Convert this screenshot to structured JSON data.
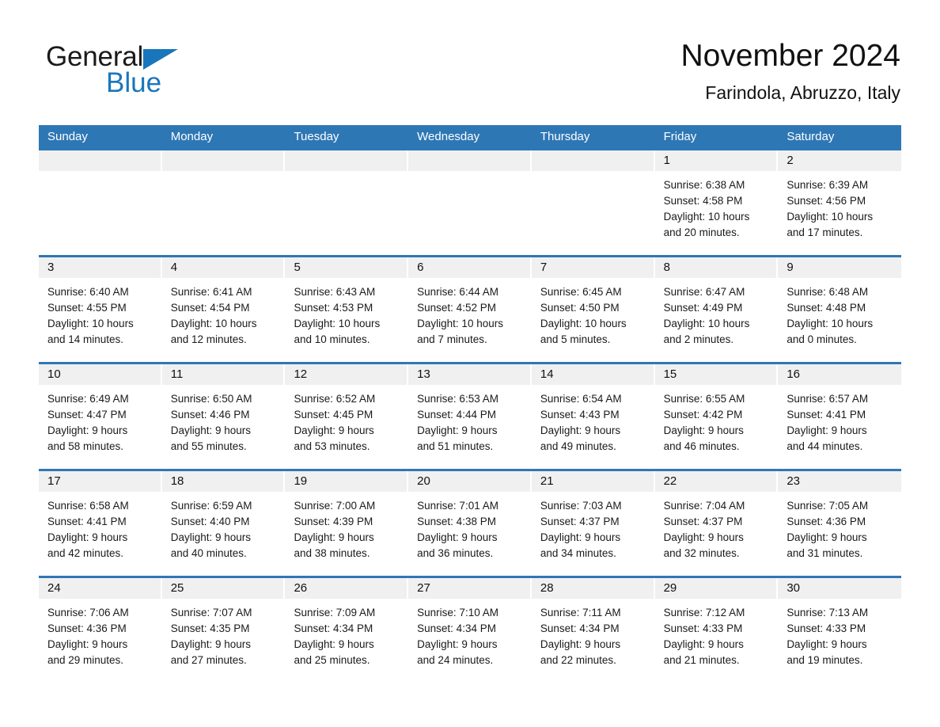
{
  "brand": {
    "name_part1": "General",
    "name_part2": "Blue",
    "flag_icon": "triangle-flag-icon",
    "accent_color": "#1a76bc"
  },
  "header": {
    "title": "November 2024",
    "subtitle": "Farindola, Abruzzo, Italy"
  },
  "colors": {
    "header_blue": "#2e77b5",
    "day_band_gray": "#f0f0f0",
    "text": "#1a1a1a"
  },
  "weekdays": [
    "Sunday",
    "Monday",
    "Tuesday",
    "Wednesday",
    "Thursday",
    "Friday",
    "Saturday"
  ],
  "weeks": [
    [
      {
        "day": "",
        "sunrise": "",
        "sunset": "",
        "daylight_line1": "",
        "daylight_line2": ""
      },
      {
        "day": "",
        "sunrise": "",
        "sunset": "",
        "daylight_line1": "",
        "daylight_line2": ""
      },
      {
        "day": "",
        "sunrise": "",
        "sunset": "",
        "daylight_line1": "",
        "daylight_line2": ""
      },
      {
        "day": "",
        "sunrise": "",
        "sunset": "",
        "daylight_line1": "",
        "daylight_line2": ""
      },
      {
        "day": "",
        "sunrise": "",
        "sunset": "",
        "daylight_line1": "",
        "daylight_line2": ""
      },
      {
        "day": "1",
        "sunrise": "Sunrise: 6:38 AM",
        "sunset": "Sunset: 4:58 PM",
        "daylight_line1": "Daylight: 10 hours",
        "daylight_line2": "and 20 minutes."
      },
      {
        "day": "2",
        "sunrise": "Sunrise: 6:39 AM",
        "sunset": "Sunset: 4:56 PM",
        "daylight_line1": "Daylight: 10 hours",
        "daylight_line2": "and 17 minutes."
      }
    ],
    [
      {
        "day": "3",
        "sunrise": "Sunrise: 6:40 AM",
        "sunset": "Sunset: 4:55 PM",
        "daylight_line1": "Daylight: 10 hours",
        "daylight_line2": "and 14 minutes."
      },
      {
        "day": "4",
        "sunrise": "Sunrise: 6:41 AM",
        "sunset": "Sunset: 4:54 PM",
        "daylight_line1": "Daylight: 10 hours",
        "daylight_line2": "and 12 minutes."
      },
      {
        "day": "5",
        "sunrise": "Sunrise: 6:43 AM",
        "sunset": "Sunset: 4:53 PM",
        "daylight_line1": "Daylight: 10 hours",
        "daylight_line2": "and 10 minutes."
      },
      {
        "day": "6",
        "sunrise": "Sunrise: 6:44 AM",
        "sunset": "Sunset: 4:52 PM",
        "daylight_line1": "Daylight: 10 hours",
        "daylight_line2": "and 7 minutes."
      },
      {
        "day": "7",
        "sunrise": "Sunrise: 6:45 AM",
        "sunset": "Sunset: 4:50 PM",
        "daylight_line1": "Daylight: 10 hours",
        "daylight_line2": "and 5 minutes."
      },
      {
        "day": "8",
        "sunrise": "Sunrise: 6:47 AM",
        "sunset": "Sunset: 4:49 PM",
        "daylight_line1": "Daylight: 10 hours",
        "daylight_line2": "and 2 minutes."
      },
      {
        "day": "9",
        "sunrise": "Sunrise: 6:48 AM",
        "sunset": "Sunset: 4:48 PM",
        "daylight_line1": "Daylight: 10 hours",
        "daylight_line2": "and 0 minutes."
      }
    ],
    [
      {
        "day": "10",
        "sunrise": "Sunrise: 6:49 AM",
        "sunset": "Sunset: 4:47 PM",
        "daylight_line1": "Daylight: 9 hours",
        "daylight_line2": "and 58 minutes."
      },
      {
        "day": "11",
        "sunrise": "Sunrise: 6:50 AM",
        "sunset": "Sunset: 4:46 PM",
        "daylight_line1": "Daylight: 9 hours",
        "daylight_line2": "and 55 minutes."
      },
      {
        "day": "12",
        "sunrise": "Sunrise: 6:52 AM",
        "sunset": "Sunset: 4:45 PM",
        "daylight_line1": "Daylight: 9 hours",
        "daylight_line2": "and 53 minutes."
      },
      {
        "day": "13",
        "sunrise": "Sunrise: 6:53 AM",
        "sunset": "Sunset: 4:44 PM",
        "daylight_line1": "Daylight: 9 hours",
        "daylight_line2": "and 51 minutes."
      },
      {
        "day": "14",
        "sunrise": "Sunrise: 6:54 AM",
        "sunset": "Sunset: 4:43 PM",
        "daylight_line1": "Daylight: 9 hours",
        "daylight_line2": "and 49 minutes."
      },
      {
        "day": "15",
        "sunrise": "Sunrise: 6:55 AM",
        "sunset": "Sunset: 4:42 PM",
        "daylight_line1": "Daylight: 9 hours",
        "daylight_line2": "and 46 minutes."
      },
      {
        "day": "16",
        "sunrise": "Sunrise: 6:57 AM",
        "sunset": "Sunset: 4:41 PM",
        "daylight_line1": "Daylight: 9 hours",
        "daylight_line2": "and 44 minutes."
      }
    ],
    [
      {
        "day": "17",
        "sunrise": "Sunrise: 6:58 AM",
        "sunset": "Sunset: 4:41 PM",
        "daylight_line1": "Daylight: 9 hours",
        "daylight_line2": "and 42 minutes."
      },
      {
        "day": "18",
        "sunrise": "Sunrise: 6:59 AM",
        "sunset": "Sunset: 4:40 PM",
        "daylight_line1": "Daylight: 9 hours",
        "daylight_line2": "and 40 minutes."
      },
      {
        "day": "19",
        "sunrise": "Sunrise: 7:00 AM",
        "sunset": "Sunset: 4:39 PM",
        "daylight_line1": "Daylight: 9 hours",
        "daylight_line2": "and 38 minutes."
      },
      {
        "day": "20",
        "sunrise": "Sunrise: 7:01 AM",
        "sunset": "Sunset: 4:38 PM",
        "daylight_line1": "Daylight: 9 hours",
        "daylight_line2": "and 36 minutes."
      },
      {
        "day": "21",
        "sunrise": "Sunrise: 7:03 AM",
        "sunset": "Sunset: 4:37 PM",
        "daylight_line1": "Daylight: 9 hours",
        "daylight_line2": "and 34 minutes."
      },
      {
        "day": "22",
        "sunrise": "Sunrise: 7:04 AM",
        "sunset": "Sunset: 4:37 PM",
        "daylight_line1": "Daylight: 9 hours",
        "daylight_line2": "and 32 minutes."
      },
      {
        "day": "23",
        "sunrise": "Sunrise: 7:05 AM",
        "sunset": "Sunset: 4:36 PM",
        "daylight_line1": "Daylight: 9 hours",
        "daylight_line2": "and 31 minutes."
      }
    ],
    [
      {
        "day": "24",
        "sunrise": "Sunrise: 7:06 AM",
        "sunset": "Sunset: 4:36 PM",
        "daylight_line1": "Daylight: 9 hours",
        "daylight_line2": "and 29 minutes."
      },
      {
        "day": "25",
        "sunrise": "Sunrise: 7:07 AM",
        "sunset": "Sunset: 4:35 PM",
        "daylight_line1": "Daylight: 9 hours",
        "daylight_line2": "and 27 minutes."
      },
      {
        "day": "26",
        "sunrise": "Sunrise: 7:09 AM",
        "sunset": "Sunset: 4:34 PM",
        "daylight_line1": "Daylight: 9 hours",
        "daylight_line2": "and 25 minutes."
      },
      {
        "day": "27",
        "sunrise": "Sunrise: 7:10 AM",
        "sunset": "Sunset: 4:34 PM",
        "daylight_line1": "Daylight: 9 hours",
        "daylight_line2": "and 24 minutes."
      },
      {
        "day": "28",
        "sunrise": "Sunrise: 7:11 AM",
        "sunset": "Sunset: 4:34 PM",
        "daylight_line1": "Daylight: 9 hours",
        "daylight_line2": "and 22 minutes."
      },
      {
        "day": "29",
        "sunrise": "Sunrise: 7:12 AM",
        "sunset": "Sunset: 4:33 PM",
        "daylight_line1": "Daylight: 9 hours",
        "daylight_line2": "and 21 minutes."
      },
      {
        "day": "30",
        "sunrise": "Sunrise: 7:13 AM",
        "sunset": "Sunset: 4:33 PM",
        "daylight_line1": "Daylight: 9 hours",
        "daylight_line2": "and 19 minutes."
      }
    ]
  ]
}
